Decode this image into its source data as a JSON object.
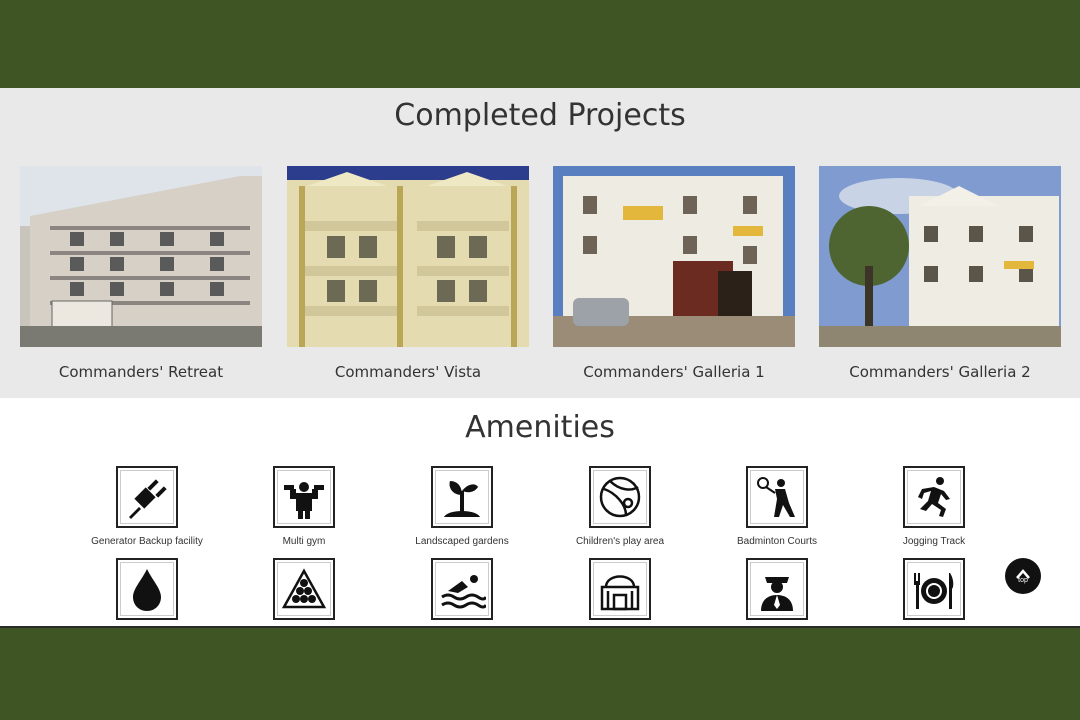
{
  "projects": {
    "heading": "Completed Projects",
    "items": [
      {
        "name": "Commanders' Retreat"
      },
      {
        "name": "Commanders' Vista"
      },
      {
        "name": "Commanders' Galleria 1"
      },
      {
        "name": "Commanders' Galleria 2"
      }
    ]
  },
  "amenities": {
    "heading": "Amenities",
    "row1": [
      {
        "label": "Generator Backup facility",
        "icon": "plug-icon"
      },
      {
        "label": "Multi gym",
        "icon": "dumbbell-icon"
      },
      {
        "label": "Landscaped gardens",
        "icon": "plant-icon"
      },
      {
        "label": "Children's play area",
        "icon": "ball-icon"
      },
      {
        "label": "Badminton Courts",
        "icon": "badminton-icon"
      },
      {
        "label": "Jogging Track",
        "icon": "runner-icon"
      }
    ],
    "row2": [
      {
        "icon": "water-drop-icon"
      },
      {
        "icon": "billiards-icon"
      },
      {
        "icon": "swimming-icon"
      },
      {
        "icon": "clubhouse-icon"
      },
      {
        "icon": "security-guard-icon"
      },
      {
        "icon": "dining-icon"
      }
    ]
  },
  "to_top": {
    "label": "top"
  },
  "colors": {
    "band": "#3f5523",
    "section_bg": "#e9e9e9"
  }
}
